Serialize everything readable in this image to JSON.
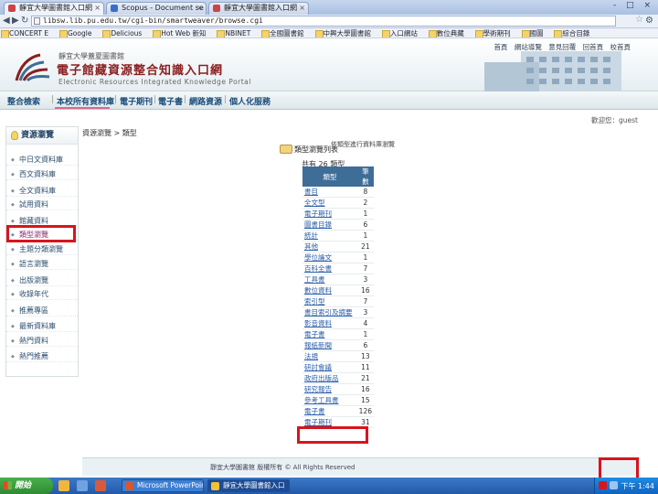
{
  "browser": {
    "tabs": [
      {
        "title": "靜宜大學圖書館入口網"
      },
      {
        "title": "Scopus - Document se"
      },
      {
        "title": "靜宜大學圖書館入口網"
      }
    ],
    "window_controls": "- □ ×",
    "url": "libsw.lib.pu.edu.tw/cgi-bin/smartweaver/browse.cgi",
    "bookmarks": [
      "CONCERT E",
      "Google",
      "Delicious",
      "Hot Web 新知",
      "NBINET",
      "全國圖書館",
      "中興大學圖書館",
      "入口網站",
      "數位典藏",
      "學術期刊",
      "國圖",
      "綜合目錄"
    ]
  },
  "header": {
    "library_name": "靜宜大學蓋夏圖書館",
    "portal_title": "電子館藏資源整合知識入口網",
    "portal_subtitle": "Electronic Resources Integrated Knowledge Portal",
    "top_links": [
      "首頁",
      "網站導覽",
      "意見回覆",
      "回首頁",
      "校首頁"
    ]
  },
  "nav": {
    "items": [
      "整合檢索",
      "本校所有資料庫",
      "電子期刊",
      "電子書",
      "網路資源",
      "個人化服務"
    ]
  },
  "welcome": "歡迎您：guest",
  "sidebar": {
    "title": "資源瀏覽",
    "items": [
      "中日文資料庫",
      "西文資料庫",
      "全文資料庫",
      "試用資料",
      "館藏資料",
      "類型瀏覽",
      "主題分類瀏覽",
      "語言瀏覽",
      "出版瀏覽",
      "收錄年代",
      "推薦專區",
      "最新資料庫",
      "熱門資料",
      "熱門推薦"
    ],
    "current_index": 5
  },
  "main": {
    "breadcrumb": "資源瀏覽 > 類型",
    "browse_label": "類型瀏覽列表",
    "browse_note": "依類型進行資料庫瀏覽",
    "total_text": "共有 26 類型",
    "table": {
      "headers": [
        "類型",
        "筆數"
      ],
      "rows": [
        {
          "name": "書目",
          "count": "8"
        },
        {
          "name": "全文型",
          "count": "2"
        },
        {
          "name": "電子期刊",
          "count": "1"
        },
        {
          "name": "圖書目錄",
          "count": "6"
        },
        {
          "name": "統計",
          "count": "1"
        },
        {
          "name": "其他",
          "count": "21"
        },
        {
          "name": "學位論文",
          "count": "1"
        },
        {
          "name": "百科全書",
          "count": "7"
        },
        {
          "name": "工具書",
          "count": "3"
        },
        {
          "name": "數位資料",
          "count": "16"
        },
        {
          "name": "索引型",
          "count": "7"
        },
        {
          "name": "書目索引及摘要",
          "count": "3"
        },
        {
          "name": "影音資料",
          "count": "4"
        },
        {
          "name": "電子書",
          "count": "1"
        },
        {
          "name": "報紙新聞",
          "count": "6"
        },
        {
          "name": "法規",
          "count": "13"
        },
        {
          "name": "研討會議",
          "count": "11"
        },
        {
          "name": "政府出版品",
          "count": "21"
        },
        {
          "name": "研究報告",
          "count": "16"
        },
        {
          "name": "參考工具書",
          "count": "15"
        },
        {
          "name": "電子書",
          "count": "126"
        },
        {
          "name": "電子期刊",
          "count": "31"
        }
      ]
    }
  },
  "footer": "靜宜大學圖書館 版權所有 © All Rights Reserved",
  "taskbar": {
    "start_label": "開始",
    "tasks": [
      "Microsoft PowerPoint",
      "靜宜大學圖書館入口"
    ],
    "clock": "下午 1:44"
  },
  "colors": {
    "highlight": "#d8141c",
    "nav_text": "#1c4d7a",
    "table_header": "#3e6d97",
    "title_red": "#8b1e1e"
  }
}
